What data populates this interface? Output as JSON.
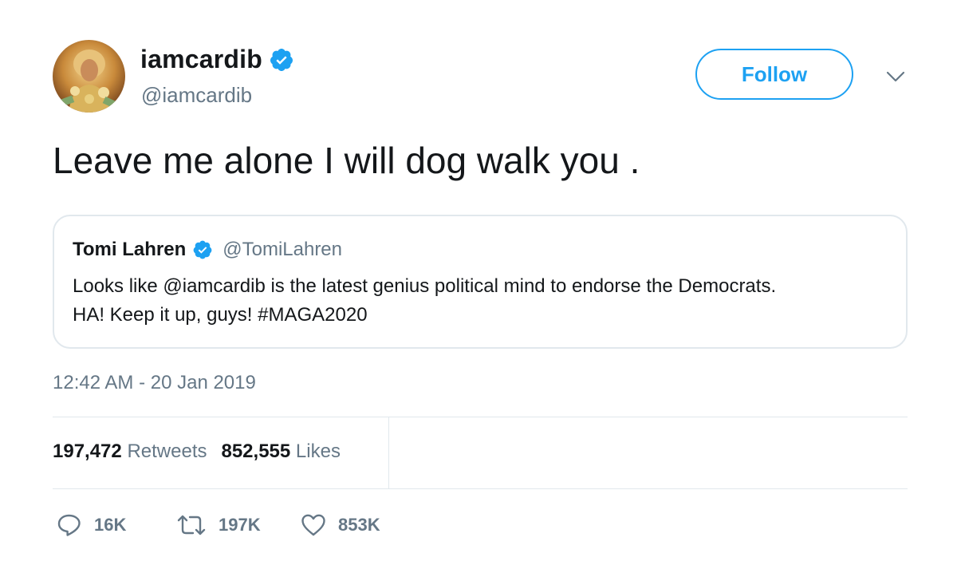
{
  "author": {
    "display_name": "iamcardib",
    "handle": "@iamcardib",
    "avatar_icon": "avatar-photo",
    "verified_icon": "verified-badge-icon"
  },
  "follow_button": {
    "label": "Follow"
  },
  "tweet": {
    "text": "Leave me alone I will dog walk you ."
  },
  "quoted_tweet": {
    "display_name": "Tomi Lahren",
    "handle": "@TomiLahren",
    "lines": [
      "Looks like @iamcardib is the latest genius political mind to endorse the Democrats.",
      "HA! Keep it up, guys! #MAGA2020"
    ]
  },
  "timestamp": "12:42 AM - 20 Jan 2019",
  "stats": {
    "retweets_count": "197,472",
    "retweets_label": "Retweets",
    "likes_count": "852,555",
    "likes_label": "Likes"
  },
  "actions": {
    "reply_count": "16K",
    "retweet_count": "197K",
    "like_count": "853K"
  },
  "colors": {
    "accent": "#1da1f2",
    "secondary_text": "#657786",
    "border": "#e1e8ed",
    "primary_text": "#14171a"
  }
}
